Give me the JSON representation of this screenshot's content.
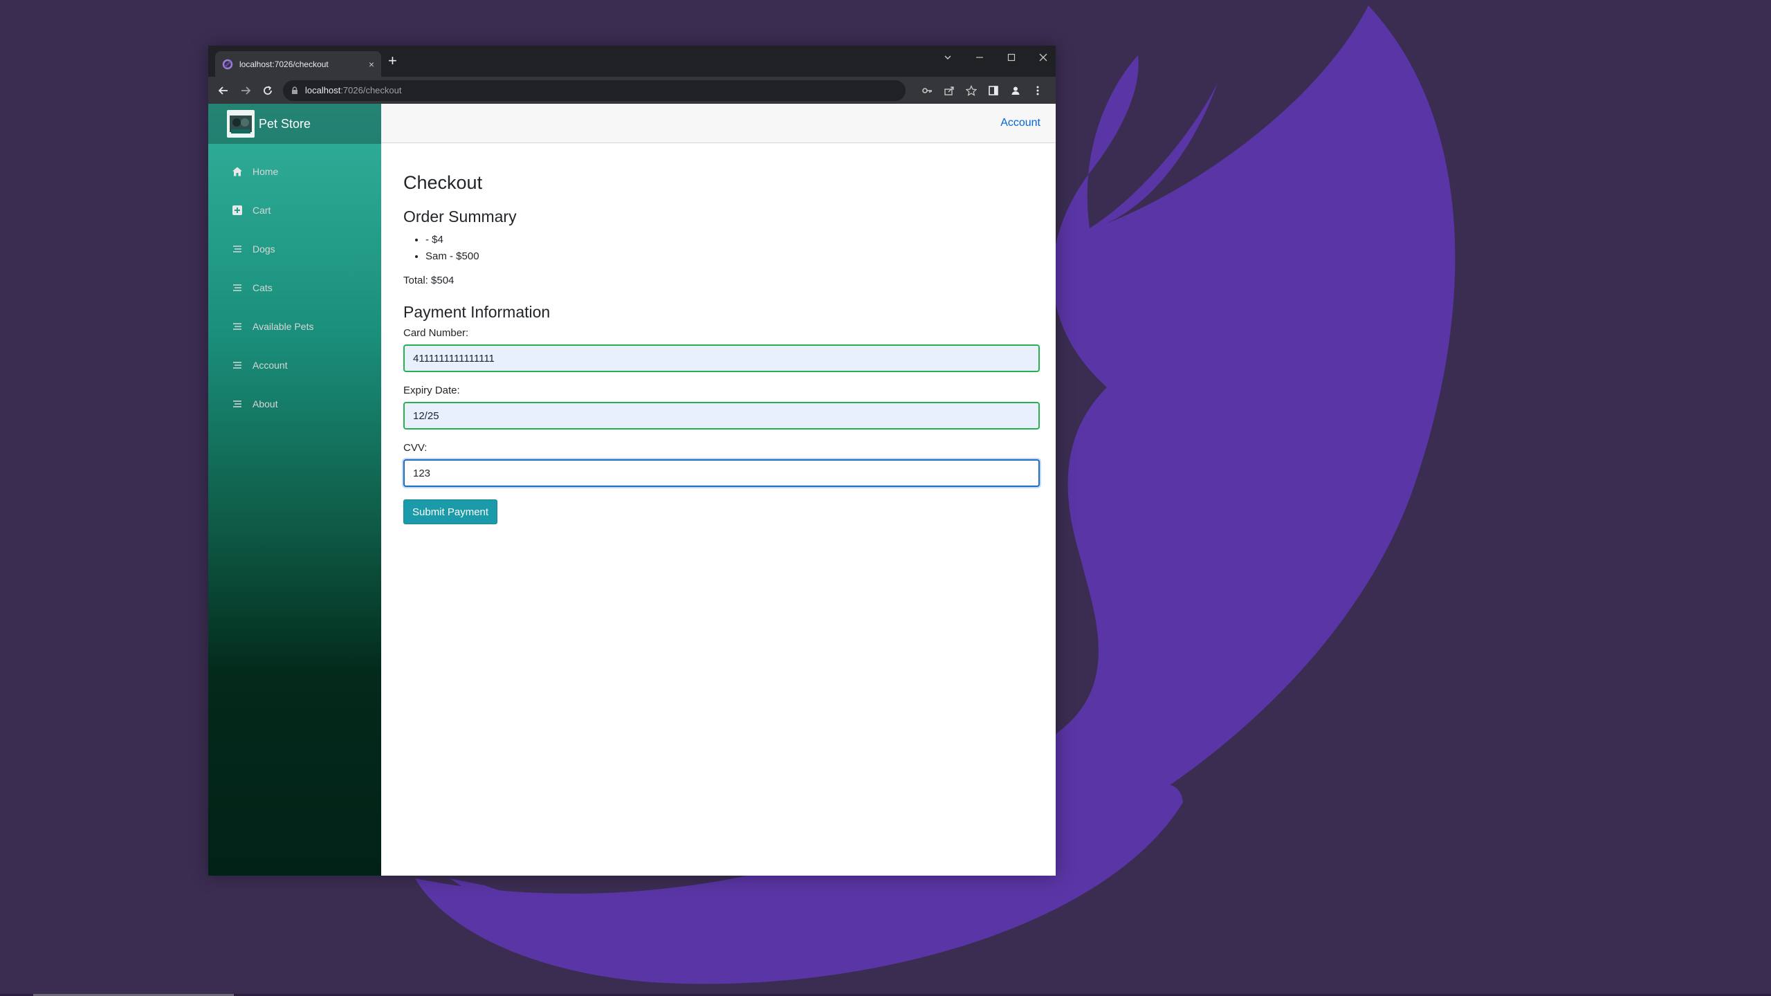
{
  "browser": {
    "tab_title": "localhost:7026/checkout",
    "tab_close": "×",
    "new_tab": "+",
    "url_host": "localhost",
    "url_path": ":7026/checkout"
  },
  "sidebar": {
    "brand": "Pet Store",
    "items": [
      {
        "label": "Home",
        "icon": "home-icon"
      },
      {
        "label": "Cart",
        "icon": "plus-square-icon"
      },
      {
        "label": "Dogs",
        "icon": "list-icon"
      },
      {
        "label": "Cats",
        "icon": "list-icon"
      },
      {
        "label": "Available Pets",
        "icon": "list-icon"
      },
      {
        "label": "Account",
        "icon": "list-icon"
      },
      {
        "label": "About",
        "icon": "list-icon"
      }
    ]
  },
  "topbar": {
    "account_link": "Account"
  },
  "checkout": {
    "title": "Checkout",
    "summary_heading": "Order Summary",
    "items": [
      "- $4",
      "Sam - $500"
    ],
    "total": "Total: $504",
    "payment_heading": "Payment Information",
    "card_label": "Card Number:",
    "card_value": "4111111111111111",
    "expiry_label": "Expiry Date:",
    "expiry_value": "12/25",
    "cvv_label": "CVV:",
    "cvv_value": "123",
    "submit_label": "Submit Payment"
  },
  "colors": {
    "sidebar_top": "#31b09b",
    "sidebar_bottom": "#022217",
    "link": "#0366d6",
    "submit_button": "#1b9aaa",
    "desktop_bg": "#3b2d52",
    "desktop_logo": "#5a35a5"
  }
}
